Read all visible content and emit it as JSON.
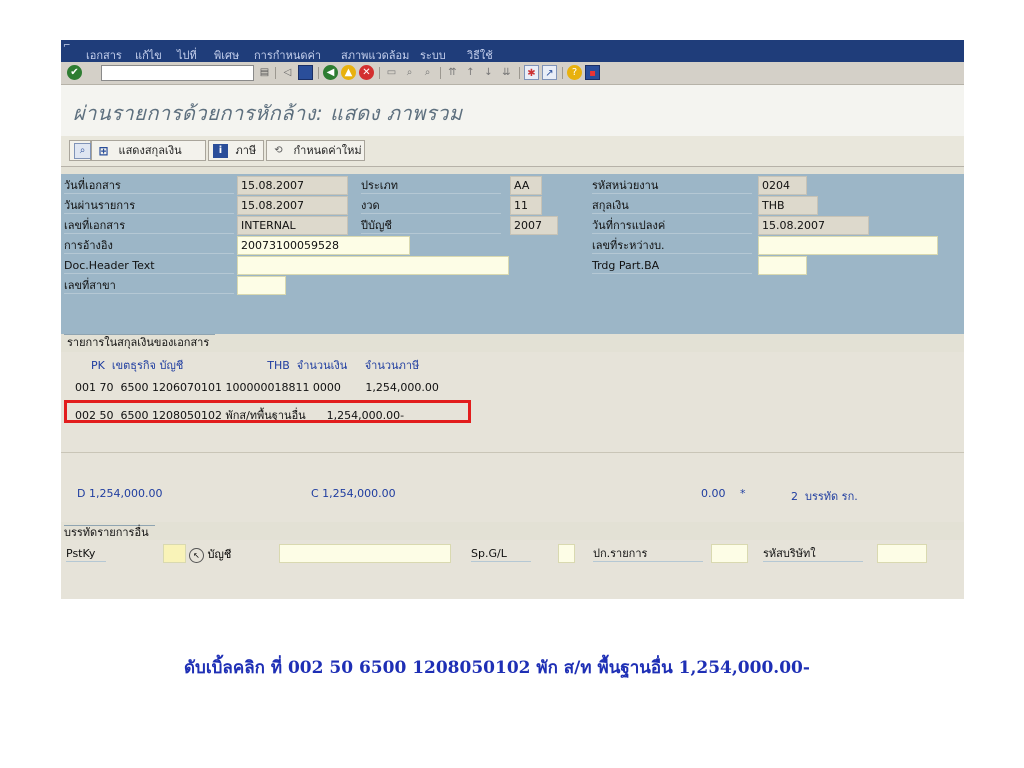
{
  "menubar": {
    "corner": "⌐",
    "items": [
      "เอกสาร",
      "แก้ไข",
      "ไปที่",
      "พิเศษ",
      "การกำหนดค่า",
      "สภาพแวดล้อม",
      "ระบบ",
      "วิธีใช้"
    ]
  },
  "toolbar": {
    "command_value": "",
    "icons": [
      "enter-icon",
      "dropdown-icon",
      "back-nav-icon",
      "save-icon",
      "back-icon",
      "exit-icon",
      "cancel-icon",
      "print-icon",
      "find-icon",
      "find-next-icon",
      "first-page-icon",
      "prev-page-icon",
      "next-page-icon",
      "last-page-icon",
      "create-session-icon",
      "shortcut-icon",
      "help-icon",
      "layout-icon"
    ]
  },
  "title": "ผ่านรายการด้วยการหักล้าง: แสดง ภาพรวม",
  "app_toolbar": {
    "btn1_label": "",
    "btn2_label": "แสดงสกุลเงิน",
    "btn3_label": "ภาษี",
    "btn4_label": "กำหนดค่าใหม่"
  },
  "header": {
    "doc_date_label": "วันที่เอกสาร",
    "doc_date": "15.08.2007",
    "post_date_label": "วันผ่านรายการ",
    "post_date": "15.08.2007",
    "doc_no_label": "เลขที่เอกสาร",
    "doc_no": "INTERNAL",
    "ref_label": "การอ้างอิง",
    "ref": "20073100059528",
    "doc_header_label": "Doc.Header Text",
    "doc_header": "",
    "branch_label": "เลขที่สาขา",
    "branch": "",
    "type_label": "ประเภท",
    "type": "AA",
    "period_label": "งวด",
    "period": "11",
    "fiscal_year_label": "ปีบัญชี",
    "fiscal_year": "2007",
    "unit_code_label": "รหัสหน่วยงาน",
    "unit_code": "0204",
    "currency_label": "สกุลเงิน",
    "currency": "THB",
    "translation_date_label": "วันที่การแปลงค่",
    "translation_date": "15.08.2007",
    "intercompany_label": "เลขที่ระหว่างบ.",
    "intercompany": "",
    "trading_ba_label": "Trdg Part.BA",
    "trading_ba": ""
  },
  "items": {
    "group_title": "รายการในสกุลเงินของเอกสาร",
    "col_header": "PK  เขตธุรกิจ บัญชี                        THB  จำนวนเงิน     จำนวนภาษี",
    "row1": "001 70  6500 1206070101 100000018811 0000       1,254,000.00",
    "row2": "002 50  6500 1208050102 พักส/ทพื้นฐานอื่น      1,254,000.00-"
  },
  "totals": {
    "debit": "D  1,254,000.00",
    "credit": "C  1,254,000.00",
    "balance": "0.00",
    "star": "*",
    "lines": "2  บรรทัด รก."
  },
  "other_line": {
    "group_title": "บรรทัดรายการอื่น",
    "pstky_label": "PstKy",
    "account_label": "บัญชี",
    "spgl_label": "Sp.G/L",
    "trans_type_label": "ปก.รายการ",
    "company_code_label": "รหัสบริษัทใ"
  },
  "caption": "ดับเบิ้ลคลิก ที่ 002  50  6500  1208050102 พัก ส/ท พื้นฐานอื่น  1,254,000.00-",
  "colors": {
    "menubar": "#1f3d7a",
    "header_panel": "#9cb6c7",
    "highlight": "#e21d1d",
    "caption": "#1e2fb5"
  }
}
